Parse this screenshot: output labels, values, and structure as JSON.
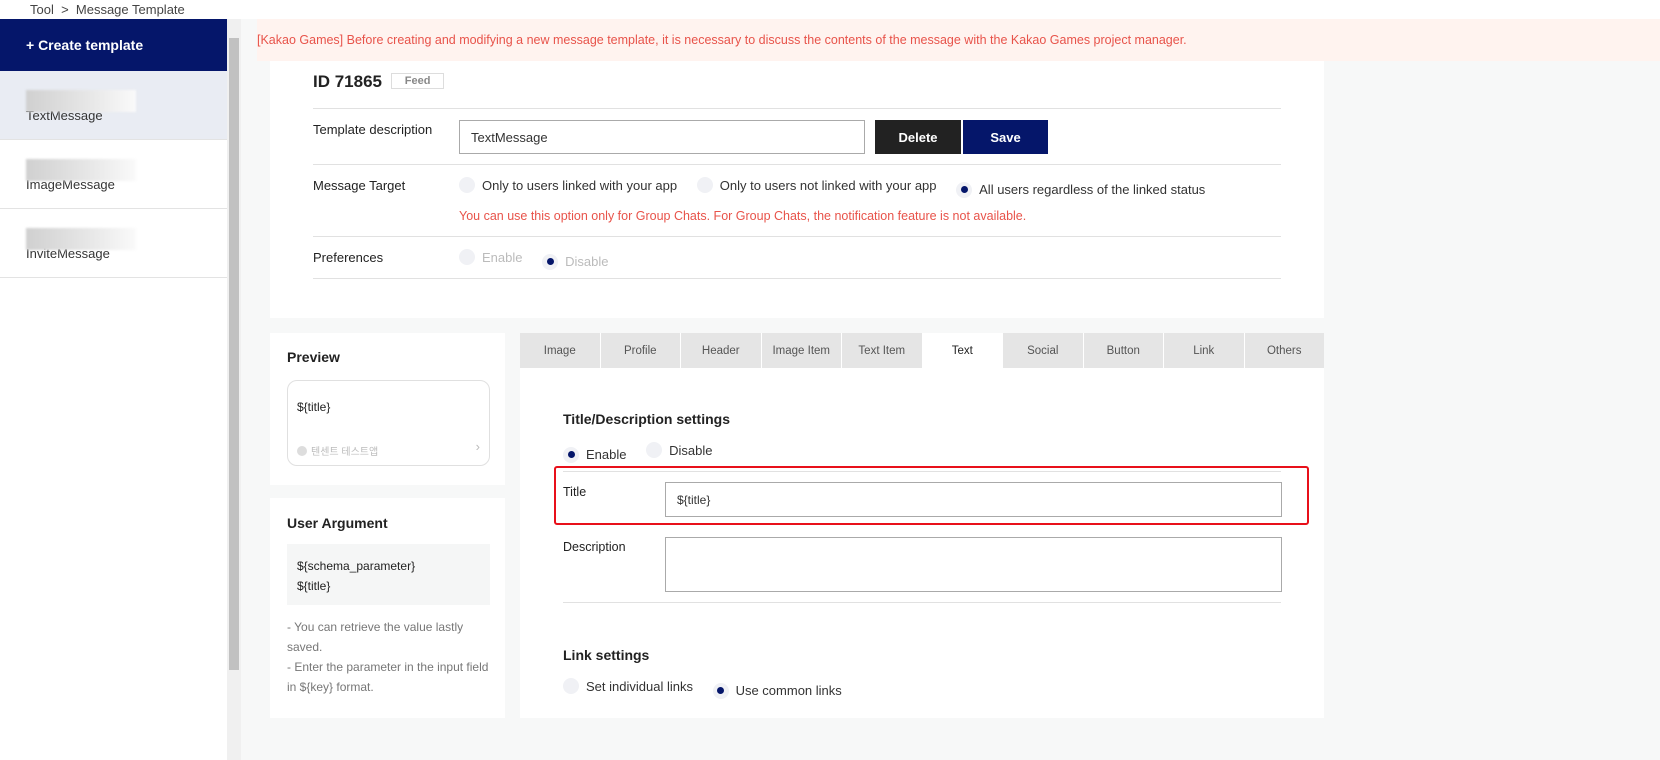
{
  "breadcrumb": "Tool  >  Message Template",
  "sidebar": {
    "create_label": "+ Create template",
    "items": [
      {
        "label": "TextMessage"
      },
      {
        "label": "ImageMessage"
      },
      {
        "label": "InviteMessage"
      }
    ]
  },
  "banner": "[Kakao Games] Before creating and modifying a new message template, it is necessary to discuss the contents of the message with the Kakao Games project manager.",
  "template": {
    "id": "ID 71865",
    "type": "Feed",
    "description_label": "Template description",
    "description_value": "TextMessage",
    "delete_label": "Delete",
    "save_label": "Save",
    "target_label": "Message Target",
    "target_options": [
      "Only to users linked with your app",
      "Only to users not linked with your app",
      "All users regardless of the linked status"
    ],
    "target_warning": "You can use this option only for Group Chats. For Group Chats, the notification feature is not available.",
    "preferences_label": "Preferences",
    "preferences_options": [
      "Enable",
      "Disable"
    ]
  },
  "preview": {
    "title": "Preview",
    "message": "${title}",
    "app_name": "텐센트 테스트앱"
  },
  "user_argument": {
    "title": "User Argument",
    "args": [
      "${schema_parameter}",
      "${title}"
    ],
    "note1": "- You can retrieve the value lastly saved.",
    "note2": "- Enter the parameter in the input field in ${key} format."
  },
  "tabs": [
    "Image",
    "Profile",
    "Header",
    "Image Item",
    "Text Item",
    "Text",
    "Social",
    "Button",
    "Link",
    "Others"
  ],
  "text_tab": {
    "section_title": "Title/Description settings",
    "options": [
      "Enable",
      "Disable"
    ],
    "title_label": "Title",
    "title_value": "${title}",
    "description_label": "Description",
    "description_value": "",
    "link_title": "Link settings",
    "link_options": [
      "Set individual links",
      "Use common links"
    ]
  },
  "colors": {
    "brand": "#05166a",
    "warning": "#e8534a",
    "highlight": "#e8101a"
  }
}
